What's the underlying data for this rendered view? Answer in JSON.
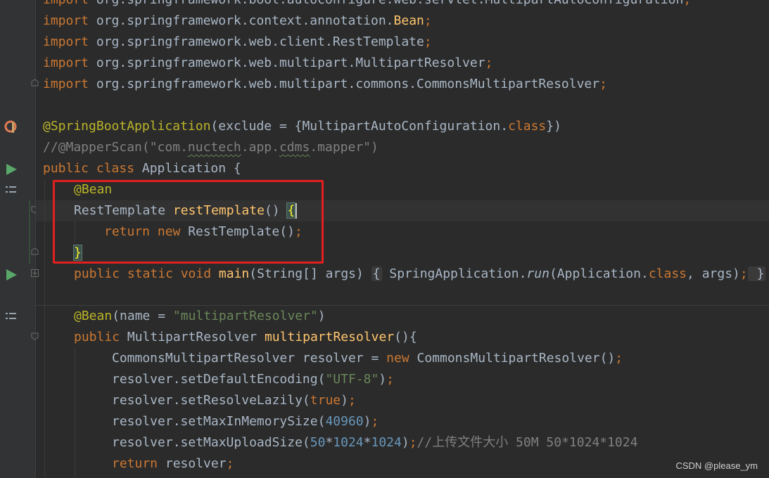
{
  "colors": {
    "background": "#2b2b2b",
    "keyword": "#cc7832",
    "annotation": "#bbb529",
    "function": "#ffc66d",
    "string": "#6a8759",
    "number": "#6897bb",
    "comment": "#808080",
    "highlight_box": "#e41f1f"
  },
  "code": {
    "l0": {
      "kw": "import",
      "rest": " org.springframework.boot.autoconfigure.web.servlet.MultipartAutoConfiguration",
      "semi": ";"
    },
    "l1": {
      "kw": "import",
      "rest": " org.springframework.context.annotation.",
      "type": "Bean",
      "semi": ";"
    },
    "l2": {
      "kw": "import",
      "rest": " org.springframework.web.client.RestTemplate",
      "semi": ";"
    },
    "l3": {
      "kw": "import",
      "rest": " org.springframework.web.multipart.MultipartResolver",
      "semi": ";"
    },
    "l4": {
      "kw": "import",
      "rest": " org.springframework.web.multipart.commons.CommonsMultipartResolver",
      "semi": ";"
    },
    "l6": {
      "ann": "@SpringBootApplication",
      "p1": "(exclude = {MultipartAutoConfiguration.",
      "kw": "class",
      "p2": "})"
    },
    "l7": {
      "c1": "//@MapperScan(\"com.",
      "c2": "nuctech",
      "c3": ".app.",
      "c4": "cdms",
      "c5": ".mapper\")"
    },
    "l8": {
      "kw": "public class",
      "rest": " Application {"
    },
    "l9": {
      "ann": "@Bean"
    },
    "l10": {
      "type": "RestTemplate ",
      "fn": "restTemplate",
      "rest": "() ",
      "brace": "{"
    },
    "l11": {
      "kw1": "return new",
      "rest": " RestTemplate()",
      "semi": ";"
    },
    "l12": {
      "brace": "}"
    },
    "l13": {
      "kw": "public static void",
      "fn": "main",
      "args": "(String[] args) ",
      "b1": "{",
      "call1": " SpringApplication.",
      "run": "run",
      "call2": "(Application.",
      "kw2": "class",
      "call3": ", args)",
      "semi": ";",
      "b2": " }"
    },
    "l15": {
      "ann": "@Bean",
      "p1": "(name = ",
      "str": "\"multipartResolver\"",
      "p2": ")"
    },
    "l16": {
      "kw": "public",
      "type": " MultipartResolver ",
      "fn": "multipartResolver",
      "rest": "(){"
    },
    "l17": {
      "p1": "CommonsMultipartResolver resolver = ",
      "kw": "new",
      "p2": " CommonsMultipartResolver()",
      "semi": ";"
    },
    "l18": {
      "p1": "resolver.setDefaultEncoding(",
      "str": "\"UTF-8\"",
      "p2": ")",
      "semi": ";"
    },
    "l19": {
      "p1": "resolver.setResolveLazily(",
      "kw": "true",
      "p2": ")",
      "semi": ";"
    },
    "l20": {
      "p1": "resolver.setMaxInMemorySize(",
      "num": "40960",
      "p2": ")",
      "semi": ";"
    },
    "l21": {
      "p1": "resolver.setMaxUploadSize(",
      "n1": "50",
      "op1": "*",
      "n2": "1024",
      "op2": "*",
      "n3": "1024",
      "p2": ")",
      "semi": ";",
      "cmt": "//上传文件大小 50M 50*1024*1024"
    },
    "l22": {
      "kw": "return",
      "rest": " resolver",
      "semi": ";"
    }
  },
  "watermark": "CSDN @please_ym"
}
